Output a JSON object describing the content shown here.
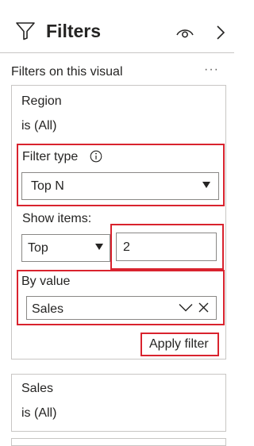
{
  "header": {
    "title": "Filters",
    "icons": [
      "filter-icon",
      "eye-icon",
      "chevron-right-icon"
    ]
  },
  "section": {
    "title": "Filters on this visual",
    "more": "···"
  },
  "region_card": {
    "field": "Region",
    "state": "is (All)",
    "filter_type_label": "Filter type",
    "filter_type_value": "Top N",
    "show_items_label": "Show items:",
    "show_items_direction": "Top",
    "show_items_count": "2",
    "by_value_label": "By value",
    "by_value_field": "Sales",
    "apply_label": "Apply filter"
  },
  "sales_card": {
    "field": "Sales",
    "state": "is (All)"
  },
  "highlight_color": "#d9232e"
}
